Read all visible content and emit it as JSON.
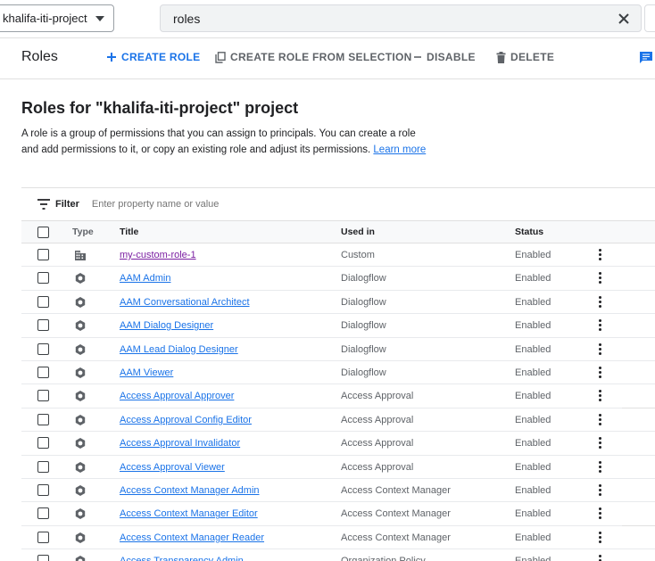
{
  "topbar": {
    "project_name": "khalifa-iti-project",
    "search_value": "roles"
  },
  "toolbar": {
    "heading": "Roles",
    "create_role": "CREATE ROLE",
    "create_from_selection": "CREATE ROLE FROM SELECTION",
    "disable": "DISABLE",
    "delete": "DELETE"
  },
  "content": {
    "title": "Roles for \"khalifa-iti-project\" project",
    "description": "A role is a group of permissions that you can assign to principals. You can create a role and add permissions to it, or copy an existing role and adjust its permissions.",
    "learn_more": "Learn more"
  },
  "filter": {
    "label": "Filter",
    "placeholder": "Enter property name or value"
  },
  "table": {
    "columns": {
      "type": "Type",
      "title": "Title",
      "used_in": "Used in",
      "status": "Status"
    },
    "rows": [
      {
        "type_icon": "building-icon",
        "title": "my-custom-role-1",
        "used_in": "Custom",
        "status": "Enabled"
      },
      {
        "type_icon": "gcp-hexagon-icon",
        "title": "AAM Admin",
        "used_in": "Dialogflow",
        "status": "Enabled"
      },
      {
        "type_icon": "gcp-hexagon-icon",
        "title": "AAM Conversational Architect",
        "used_in": "Dialogflow",
        "status": "Enabled"
      },
      {
        "type_icon": "gcp-hexagon-icon",
        "title": "AAM Dialog Designer",
        "used_in": "Dialogflow",
        "status": "Enabled"
      },
      {
        "type_icon": "gcp-hexagon-icon",
        "title": "AAM Lead Dialog Designer",
        "used_in": "Dialogflow",
        "status": "Enabled"
      },
      {
        "type_icon": "gcp-hexagon-icon",
        "title": "AAM Viewer",
        "used_in": "Dialogflow",
        "status": "Enabled"
      },
      {
        "type_icon": "gcp-hexagon-icon",
        "title": "Access Approval Approver",
        "used_in": "Access Approval",
        "status": "Enabled"
      },
      {
        "type_icon": "gcp-hexagon-icon",
        "title": "Access Approval Config Editor",
        "used_in": "Access Approval",
        "status": "Enabled"
      },
      {
        "type_icon": "gcp-hexagon-icon",
        "title": "Access Approval Invalidator",
        "used_in": "Access Approval",
        "status": "Enabled"
      },
      {
        "type_icon": "gcp-hexagon-icon",
        "title": "Access Approval Viewer",
        "used_in": "Access Approval",
        "status": "Enabled"
      },
      {
        "type_icon": "gcp-hexagon-icon",
        "title": "Access Context Manager Admin",
        "used_in": "Access Context Manager",
        "status": "Enabled"
      },
      {
        "type_icon": "gcp-hexagon-icon",
        "title": "Access Context Manager Editor",
        "used_in": "Access Context Manager",
        "status": "Enabled"
      },
      {
        "type_icon": "gcp-hexagon-icon",
        "title": "Access Context Manager Reader",
        "used_in": "Access Context Manager",
        "status": "Enabled"
      },
      {
        "type_icon": "gcp-hexagon-icon",
        "title": "Access Transparency Admin",
        "used_in": "Organization Policy",
        "status": "Enabled"
      }
    ]
  }
}
